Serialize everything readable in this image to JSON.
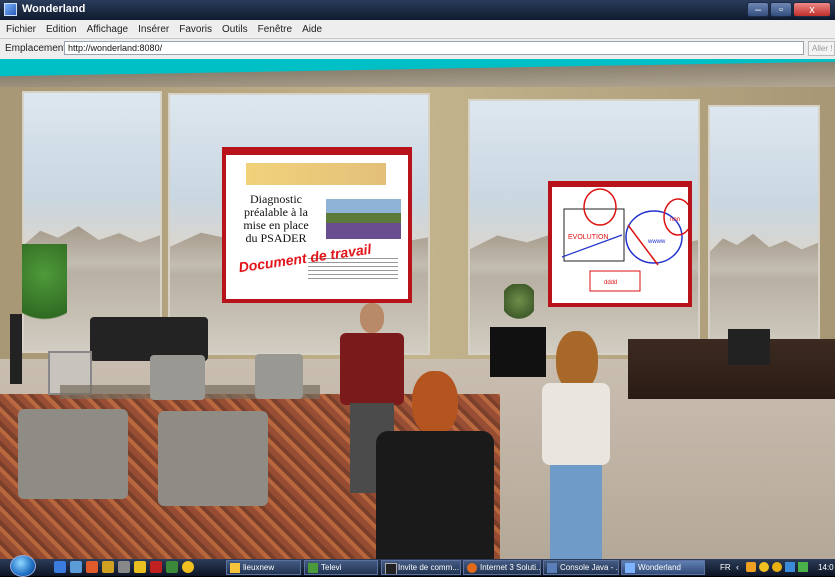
{
  "window": {
    "title": "Wonderland",
    "minimize": "–",
    "maximize": "▫",
    "close": "x"
  },
  "menu": [
    "Fichier",
    "Edition",
    "Affichage",
    "Insérer",
    "Favoris",
    "Outils",
    "Fenêtre",
    "Aide"
  ],
  "address": {
    "label": "Emplacement:",
    "url": "http://wonderland:8080/",
    "go": "Aller !"
  },
  "board1": {
    "title_text": "Diagnostic préalable à la mise en place du PSADER",
    "stamp": "Document de travail"
  },
  "board2": {
    "evolution": "EVOLUTION",
    "ww": "wwww",
    "nn": "nnn",
    "dd": "dddd"
  },
  "taskbar": {
    "tasks": [
      "lieuxnew",
      "Televi",
      "Invite de comm...",
      "Internet 3 Soluti...",
      "Console Java - ...",
      "Wonderland"
    ],
    "lang": "FR",
    "clock": "14:0"
  },
  "colors": {
    "teal": "#00c0c6",
    "board_border": "#b8121a"
  }
}
